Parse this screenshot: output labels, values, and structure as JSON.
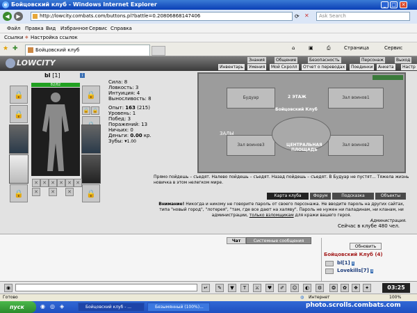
{
  "window": {
    "title": "Бойцовский клуб - Windows Internet Explorer",
    "min": "_",
    "max": "□",
    "close": "✕"
  },
  "browser": {
    "url": "http://lowcity.combats.com/buttons.pl?battle=0.20806868147406",
    "search_placeholder": "Ask Search",
    "menu": [
      "Файл",
      "Правка",
      "Вид",
      "Избранное",
      "Сервис",
      "Справка"
    ],
    "links": [
      "Ссылки",
      "Настройка ссылок"
    ],
    "tab_title": "Бойцовский клуб",
    "tools": {
      "page": "Страница",
      "service": "Сервис"
    }
  },
  "game": {
    "logo": "LOWCITY",
    "nav_top": [
      "Знания",
      "Общение",
      "Безопасность",
      "Персонаж",
      "Выход"
    ],
    "nav_sub": [
      "Инвентарь",
      "Умения",
      "Мой Скролл",
      "Отчет о переводах",
      "Поединки",
      "Анкета",
      "Настр"
    ],
    "character": {
      "name": "bl",
      "level": "[1]",
      "info": "i",
      "hp": "82/82",
      "stats": [
        {
          "label": "Сила:",
          "value": "8"
        },
        {
          "label": "Ловкость:",
          "value": "3"
        },
        {
          "label": "Интуиция:",
          "value": "4"
        },
        {
          "label": "Выносливость:",
          "value": "8"
        }
      ],
      "exp_label": "Опыт:",
      "exp_value": "163",
      "exp_next": "(215)",
      "level_label": "Уровень: 1",
      "wins_label": "Побед: 3",
      "losses_label": "Поражений: 13",
      "draws_label": "Ничьих: 0",
      "money_label": "Деньги:",
      "money_value": "0.00",
      "money_unit": "кр.",
      "teeth_label": "Зубы:",
      "teeth_value": "1.00"
    },
    "map": {
      "rooms": [
        "Будуар",
        "Зал воинов1",
        "Зал воинов2",
        "Зал воинов3"
      ],
      "floor": "2 ЭТАЖ",
      "hall": "Бойцовский Клуб",
      "halls": "ЗАЛЫ",
      "square": "ЦЕНТРАЛЬНАЯ\nПЛОЩАДЬ"
    },
    "description": "Прямо пойдешь – съедят. Налево пойдешь – съедят. Назад пойдешь – съедят. В Будуар не пустят... Тяжела жизнь новичка в этом нелегком мире.",
    "buttons": [
      "Карта клуба",
      "Форум",
      "Подсказка",
      "Объекты"
    ],
    "warning_bold": "Внимание!",
    "warning": "Никогда и никому не говорите пароль от своего персонажа. Не вводите пароль на других сайтах, типа \"новый город\", \"лотерея\", \"там, где все дают на халяву\". Пароль не нужен ни паладинам, ни кланам, ни администрации,",
    "warning_link": "только взломщикам",
    "warning_end": "для кражи вашего героя.",
    "admin": "Администрация.",
    "online": "Сейчас в клубе 480 чел.",
    "chat": {
      "tab_chat": "Чат",
      "tab_system": "Системные сообщения",
      "refresh": "Обновить",
      "club_title": "Бойцовский Клуб (4)",
      "players": [
        {
          "name": "bl",
          "level": "[1]"
        },
        {
          "name": "Lovekills",
          "level": "[7]"
        }
      ]
    },
    "clock": "03:25"
  },
  "status": {
    "left": "Готово",
    "zone": "Интернет",
    "zoom": "100%"
  },
  "taskbar": {
    "start": "пуск",
    "tasks": [
      "Бойцовский клуб - ...",
      "Безымянный (100%)..."
    ],
    "watermark": "photo.scrolls.combats.com"
  },
  "colors": {
    "titlebar": "#0a3fb6",
    "hp": "#20a020",
    "club": "#a52020",
    "player": "#1a3a7a"
  }
}
